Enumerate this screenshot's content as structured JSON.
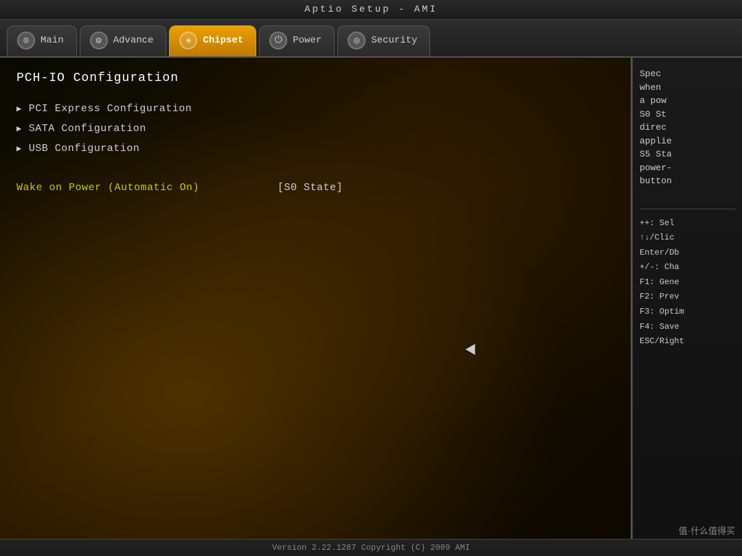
{
  "title_bar": {
    "text": "Aptio  Setup  -  AMI"
  },
  "tabs": [
    {
      "id": "main",
      "label": "Main",
      "icon": "⊙",
      "active": false
    },
    {
      "id": "advance",
      "label": "Advance",
      "icon": "⚙",
      "active": false
    },
    {
      "id": "chipset",
      "label": "Chipset",
      "icon": "✳",
      "active": true
    },
    {
      "id": "power",
      "label": "Power",
      "icon": "⏻",
      "active": false
    },
    {
      "id": "security",
      "label": "Security",
      "icon": "◎",
      "active": false
    }
  ],
  "section": {
    "title": "PCH-IO Configuration",
    "menu_items": [
      {
        "label": "PCI Express Configuration"
      },
      {
        "label": "SATA Configuration"
      },
      {
        "label": "USB Configuration"
      }
    ],
    "wake_row": {
      "label": "Wake on Power (Automatic On)",
      "value": "[S0 State]"
    }
  },
  "help": {
    "description": "Spec\nwhen\na pow\nS0 St\ndirec\napplied\nS5 Sta\npower-\nbutton",
    "keys": "++: Sel\n↑↓/Clic\nEnter/Db\n+/-: Cha\nF1: Gene\nF2: Prev\nF3: Optim\nF4: Save\nESC/Right"
  },
  "version_bar": {
    "text": "Version 2.22.1287  Copyright (C) 2009 AMI"
  },
  "watermark": {
    "text": "值·什么值得买"
  }
}
